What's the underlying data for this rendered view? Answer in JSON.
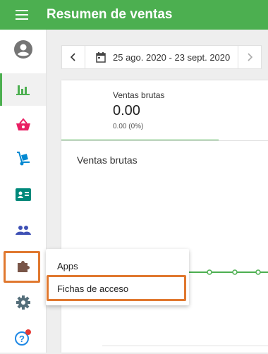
{
  "header": {
    "title": "Resumen de ventas",
    "menu_icon": "hamburger-icon"
  },
  "sidebar": {
    "items": [
      {
        "name": "profile",
        "icon": "account-circle-icon"
      },
      {
        "name": "reports",
        "icon": "bar-chart-icon",
        "active": true
      },
      {
        "name": "items",
        "icon": "basket-icon"
      },
      {
        "name": "inventory",
        "icon": "hand-truck-icon"
      },
      {
        "name": "employees",
        "icon": "id-card-icon"
      },
      {
        "name": "customers",
        "icon": "people-icon"
      },
      {
        "name": "apps",
        "icon": "puzzle-icon",
        "highlighted": true
      },
      {
        "name": "settings",
        "icon": "gear-icon"
      },
      {
        "name": "help",
        "icon": "help-icon",
        "notification": true
      }
    ]
  },
  "date_range": {
    "label": "25 ago. 2020 - 23 sept. 2020"
  },
  "metric": {
    "label": "Ventas brutas",
    "value": "0.00",
    "sub": "0.00 (0%)"
  },
  "chart": {
    "title": "Ventas brutas"
  },
  "chart_data": {
    "type": "line",
    "title": "Ventas brutas",
    "series": [
      {
        "values": [
          0,
          0,
          0,
          0,
          0
        ]
      }
    ]
  },
  "popup_menu": {
    "items": [
      {
        "label": "Apps"
      },
      {
        "label": "Fichas de acceso",
        "highlighted": true
      }
    ]
  },
  "colors": {
    "primary": "#4caf50",
    "highlight": "#e0782f",
    "notification": "#e53935"
  }
}
